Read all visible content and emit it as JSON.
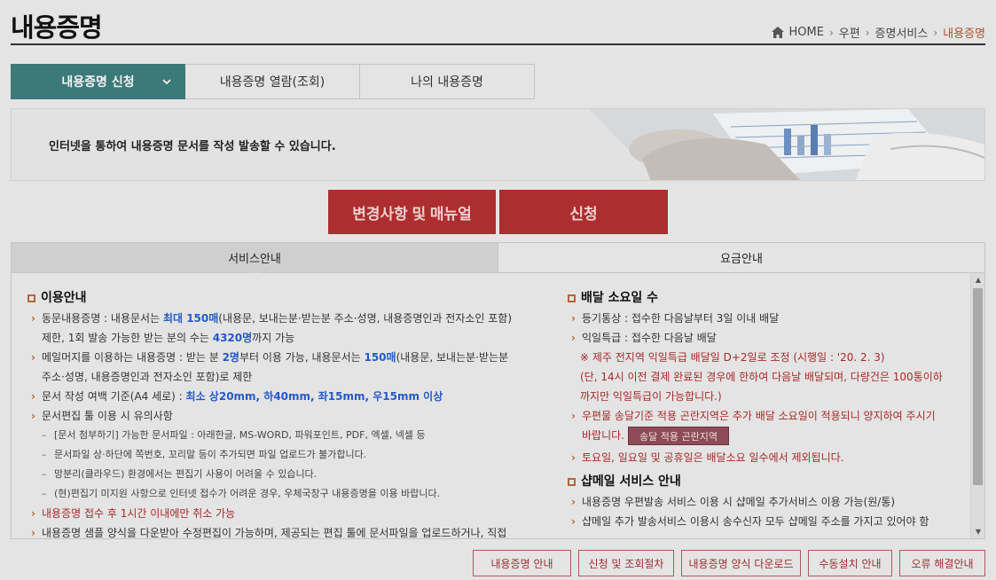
{
  "page": {
    "title": "내용증명"
  },
  "breadcrumb": {
    "items": [
      "HOME",
      "우편",
      "증명서비스",
      "내용증명"
    ]
  },
  "tabs": [
    {
      "label": "내용증명 신청",
      "active": true
    },
    {
      "label": "내용증명 열람(조회)",
      "active": false
    },
    {
      "label": "나의 내용증명",
      "active": false
    }
  ],
  "banner": {
    "text": "인터넷을 통하여 내용증명 문서를 작성 발송할 수 있습니다."
  },
  "buttons": {
    "manual": "변경사항 및 매뉴얼",
    "apply": "신청"
  },
  "panel_tabs": [
    "서비스안내",
    "요금안내"
  ],
  "left": {
    "heading": "이용안내",
    "item1_a": "동문내용증명 : 내용문서는 ",
    "item1_b": "최대 150매",
    "item1_c": "(내용문, 보내는분·받는분 주소·성명, 내용증명인과 전자소인 포함)",
    "item1_d": "제한, 1회 발송 가능한 받는 분의 수는 ",
    "item1_e": "4320명",
    "item1_f": "까지 가능",
    "item2_a": "메일머지를 이용하는 내용증명 : 받는 분 ",
    "item2_b": "2명",
    "item2_c": "부터 이용 가능, 내용문서는 ",
    "item2_d": "150매",
    "item2_e": "(내용문, 보내는분·받는분",
    "item2_f": "주소·성명, 내용증명인과 전자소인 포함)로 제한",
    "item3_a": "문서 작성 여백 기준(A4 세로) : ",
    "item3_b": "최소 상20mm, 하40mm, 좌15mm, 우15mm 이상",
    "item4": "문서편집 툴 이용 시 유의사항",
    "sub1": "[문서 첨부하기] 가능한 문서파일 : 아래한글, MS-WORD, 파워포인트, PDF, 엑셀, 넥셀 등",
    "sub2": "문서파일 상·하단에 쪽번호, 꼬리말 등이 추가되면 파일 업로드가 불가합니다.",
    "sub3": "망분리(클라우드) 환경에서는 편집기 사용이 어려울 수 있습니다.",
    "sub4": "(현)편집기 미지원 사항으로 인터넷 접수가 어려운 경우, 우체국창구 내용증명을 이용 바랍니다.",
    "item5": "내용증명 접수 후 1시간 이내에만 취소 가능",
    "item6": "내용증명 샘플 양식을 다운받아 수정편집이 가능하며, 제공되는 편집 툴에 문서파일을 업로드하거나, 직접"
  },
  "right": {
    "heading1": "배달 소요일 수",
    "r1": "등기통상 : 접수한 다음날부터 3일 이내 배달",
    "r2": "익일특급 : 접수한 다음날 배달",
    "r3": "※ 제주 전지역 익일특급 배달일 D+2일로 조정 (시행일 : '20. 2. 3)",
    "r4": "(단, 14시 이전 결제 완료된 경우에 한하여 다음날 배달되며, 다량건은 100통이하",
    "r5": "까지만 익일특급이 가능합니다.)",
    "r6": "우편물 송달기준 적용 곤란지역은 추가 배달 소요일이 적용되니 양지하여 주시기",
    "r7": "바랍니다.",
    "pill": "송달 적용 곤란지역",
    "r8": "토요일, 일요일 및 공휴일은 배달소요 일수에서 제외됩니다.",
    "heading2": "샵메일 서비스 안내",
    "r9": "내용증명 우편발송 서비스 이용 시 샵메일 추가서비스 이용 가능(원/통)",
    "r10": "샵메일 추가 발송서비스 이용시 송수신자 모두 샵메일 주소를 가지고 있어야 함"
  },
  "bottom_links": [
    "내용증명 안내",
    "신청 및 조회절차",
    "내용증명 양식 다운로드",
    "수동설치 안내",
    "오류 해결안내"
  ]
}
